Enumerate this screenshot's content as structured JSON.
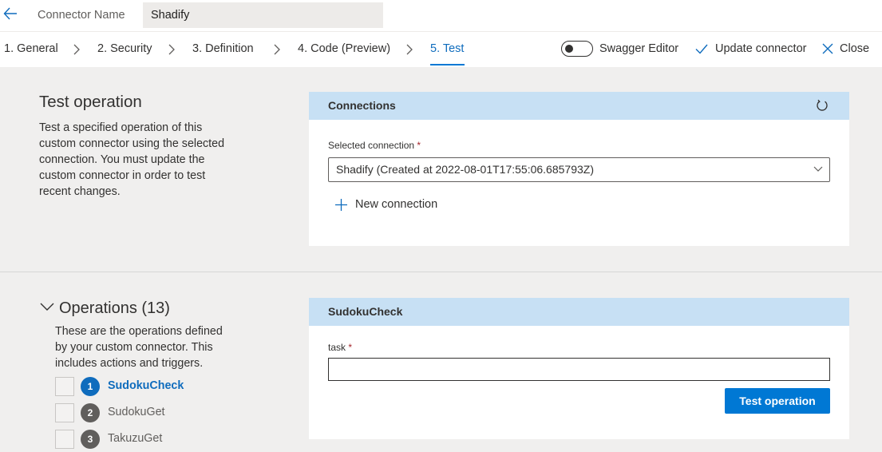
{
  "header": {
    "back_icon": "back-arrow-icon",
    "connector_name_label": "Connector Name",
    "connector_name_value": "Shadify"
  },
  "nav": {
    "steps": [
      {
        "label": "1. General"
      },
      {
        "label": "2. Security"
      },
      {
        "label": "3. Definition"
      },
      {
        "label": "4. Code (Preview)"
      },
      {
        "label": "5. Test",
        "active": true
      }
    ],
    "swagger_label": "Swagger Editor",
    "swagger_on": false,
    "update_label": "Update connector",
    "close_label": "Close"
  },
  "test_operation": {
    "title": "Test operation",
    "description": "Test a specified operation of this custom connector using the selected connection. You must update the custom connector in order to test recent changes."
  },
  "connections": {
    "header": "Connections",
    "selected_label": "Selected connection",
    "required_mark": "*",
    "selected_value": "Shadify (Created at 2022-08-01T17:55:06.685793Z)",
    "new_connection": "New connection"
  },
  "operations": {
    "title": "Operations (13)",
    "description": "These are the operations defined by your custom connector. This includes actions and triggers.",
    "items": [
      {
        "num": "1",
        "name": "SudokuCheck",
        "active": true
      },
      {
        "num": "2",
        "name": "SudokuGet",
        "active": false
      },
      {
        "num": "3",
        "name": "TakuzuGet",
        "active": false
      }
    ]
  },
  "operation_panel": {
    "header": "SudokuCheck",
    "task_label": "task",
    "required_mark": "*",
    "task_value": "",
    "button": "Test operation"
  },
  "colors": {
    "accent": "#0078d4",
    "header_blue": "#c7e0f4",
    "background": "#f0efee"
  }
}
